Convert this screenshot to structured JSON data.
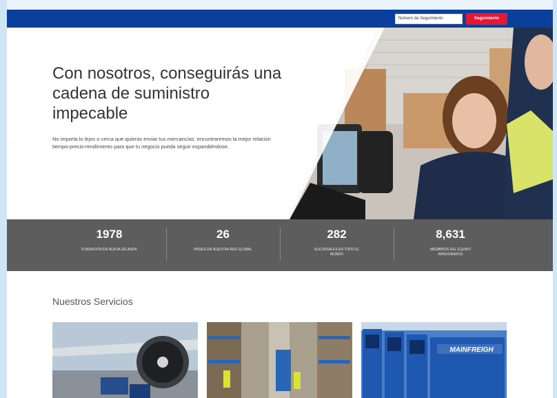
{
  "tracking": {
    "placeholder": "Número de Seguimiento",
    "button_label": "Seguimiento"
  },
  "hero": {
    "title": "Con nosotros, conseguirás una cadena de suministro impecable",
    "subtitle": "No importa lo lejos o cerca que quieras enviar tus mercancías: encontraremos la mejor relación tiempo-precio-rendimiento para que tu negocio pueda seguir expandiéndose."
  },
  "stats": [
    {
      "value": "1978",
      "label": "Fundación en Nueva Zelanda"
    },
    {
      "value": "26",
      "label": "Países en nuestra red global"
    },
    {
      "value": "282",
      "label": "Sucursales en todo el mundo"
    },
    {
      "value": "8,631",
      "label": "Miembros del equipo apasionados"
    }
  ],
  "services": {
    "title": "Nuestros Servicios",
    "cards": [
      {
        "icon": "air-freight-image"
      },
      {
        "icon": "warehouse-image"
      },
      {
        "icon": "trucks-image",
        "logo_text": "MAINFREIGH"
      }
    ]
  },
  "colors": {
    "brand_blue": "#0a3f9c",
    "accent_red": "#e31837",
    "stats_gray": "#5d5d5d"
  }
}
